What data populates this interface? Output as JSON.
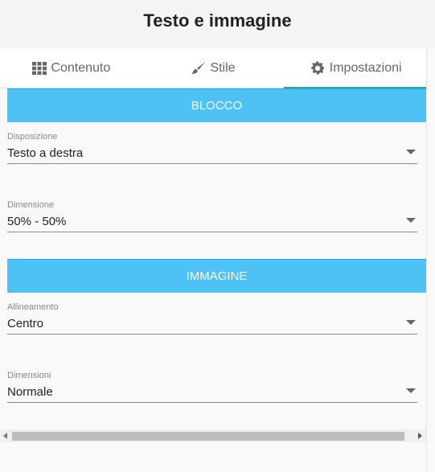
{
  "header": {
    "title": "Testo e immagine"
  },
  "tabs": [
    {
      "label": "Contenuto",
      "icon": "grid-icon"
    },
    {
      "label": "Stile",
      "icon": "brush-icon"
    },
    {
      "label": "Impostazioni",
      "icon": "gear-icon",
      "active": true
    }
  ],
  "sections": {
    "blocco": {
      "title": "BLOCCO",
      "disposizione": {
        "label": "Disposizione",
        "value": "Testo a destra"
      },
      "dimensione": {
        "label": "Dimensione",
        "value": "50% - 50%"
      }
    },
    "immagine": {
      "title": "IMMAGINE",
      "allineamento": {
        "label": "Allineamento",
        "value": "Centro"
      },
      "dimensioni": {
        "label": "Dimensioni",
        "value": "Normale"
      }
    }
  },
  "colors": {
    "section_bar": "#4ec1f5",
    "active_tab_underline": "#35a68b"
  }
}
